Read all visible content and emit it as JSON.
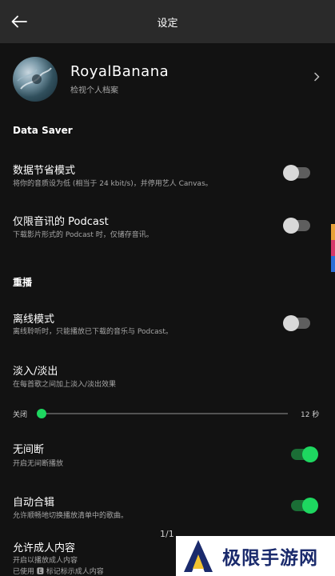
{
  "header": {
    "title": "设定",
    "back_icon": "arrow-left-icon"
  },
  "profile": {
    "name": "RoyalBanana",
    "subtitle": "检视个人档案"
  },
  "data_saver": {
    "section_title": "Data Saver",
    "rows": [
      {
        "title": "数据节省模式",
        "subtitle": "将你的音质设为低 (相当于 24 kbit/s)，并停用艺人 Canvas。",
        "enabled": false
      },
      {
        "title": "仅限音讯的 Podcast",
        "subtitle": "下载影片形式的 Podcast 时，仅储存音讯。",
        "enabled": false
      }
    ]
  },
  "playback": {
    "section_title": "重播",
    "offline": {
      "title": "离线模式",
      "subtitle": "离线聆听时，只能播放已下载的音乐与 Podcast。",
      "enabled": false
    },
    "crossfade": {
      "title": "淡入/淡出",
      "subtitle": "在每首歌之间加上淡入/淡出效果",
      "min_label": "关闭",
      "max_label": "12 秒",
      "value_seconds": 0
    },
    "gapless": {
      "title": "无间断",
      "subtitle": "开启无间断播放",
      "enabled": true
    },
    "automix": {
      "title": "自动合辑",
      "subtitle": "允许顺畅地切换播放清单中的歌曲。",
      "enabled": true
    },
    "explicit": {
      "title": "允许成人内容",
      "subtitle1": "开启以播放成人内容",
      "subtitle2": "已使用 🅴 标记标示成人内容"
    }
  },
  "page_indicator": "1/1",
  "watermark": {
    "text": "极限手游网"
  },
  "colors": {
    "accent": "#1ed760",
    "background": "#121212",
    "header": "#2a2a2a"
  }
}
